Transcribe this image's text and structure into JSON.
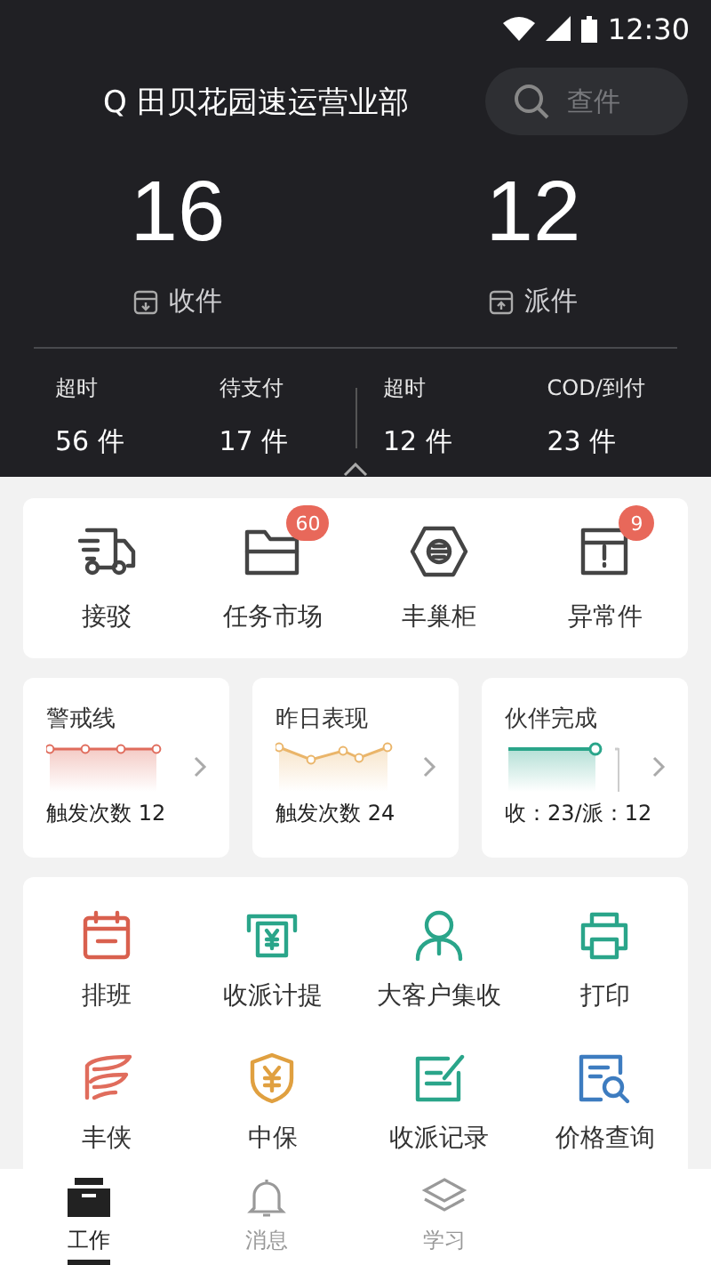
{
  "status_bar": {
    "time": "12:30"
  },
  "header": {
    "station": "Q 田贝花园速运营业部",
    "search": {
      "placeholder": "查件"
    }
  },
  "totals": [
    {
      "kind": "in",
      "value": "16",
      "label": "收件"
    },
    {
      "kind": "out",
      "value": "12",
      "label": "派件"
    }
  ],
  "stats": [
    {
      "label": "超时",
      "value": "56 件"
    },
    {
      "label": "待支付",
      "value": "17 件"
    },
    {
      "label": "超时",
      "value": "12 件"
    },
    {
      "label": "COD/到付",
      "value": "23 件"
    }
  ],
  "shortcuts": [
    {
      "kind": "truck",
      "label": "接驳"
    },
    {
      "kind": "folder",
      "label": "任务市场",
      "badge": "60"
    },
    {
      "kind": "locker",
      "label": "丰巢柜"
    },
    {
      "kind": "box",
      "label": "异常件",
      "badge": "9"
    }
  ],
  "metric_cards": [
    {
      "kind": "flat",
      "title": "警戒线",
      "value": "触发次数 12",
      "color": "#e06c5c"
    },
    {
      "kind": "wave",
      "title": "昨日表现",
      "value": "触发次数 24",
      "color": "#eab56a"
    },
    {
      "kind": "progress",
      "title": "伙伴完成",
      "value": "收：23/派：12",
      "color": "#2aa58a",
      "level": 0.79
    }
  ],
  "tools": [
    {
      "kind": "calendar",
      "label": "排班"
    },
    {
      "kind": "receipt",
      "label": "收派计提"
    },
    {
      "kind": "person",
      "label": "大客户集收"
    },
    {
      "kind": "printer",
      "label": "打印"
    },
    {
      "kind": "wing",
      "label": "丰侠"
    },
    {
      "kind": "shield",
      "label": "中保"
    },
    {
      "kind": "edit",
      "label": "收派记录"
    },
    {
      "kind": "doc-search",
      "label": "价格查询"
    }
  ],
  "tabs": [
    {
      "kind": "work",
      "label": "工作",
      "selected": true
    },
    {
      "kind": "bell",
      "label": "消息",
      "selected": false
    },
    {
      "kind": "layers",
      "label": "学习",
      "selected": false
    }
  ]
}
